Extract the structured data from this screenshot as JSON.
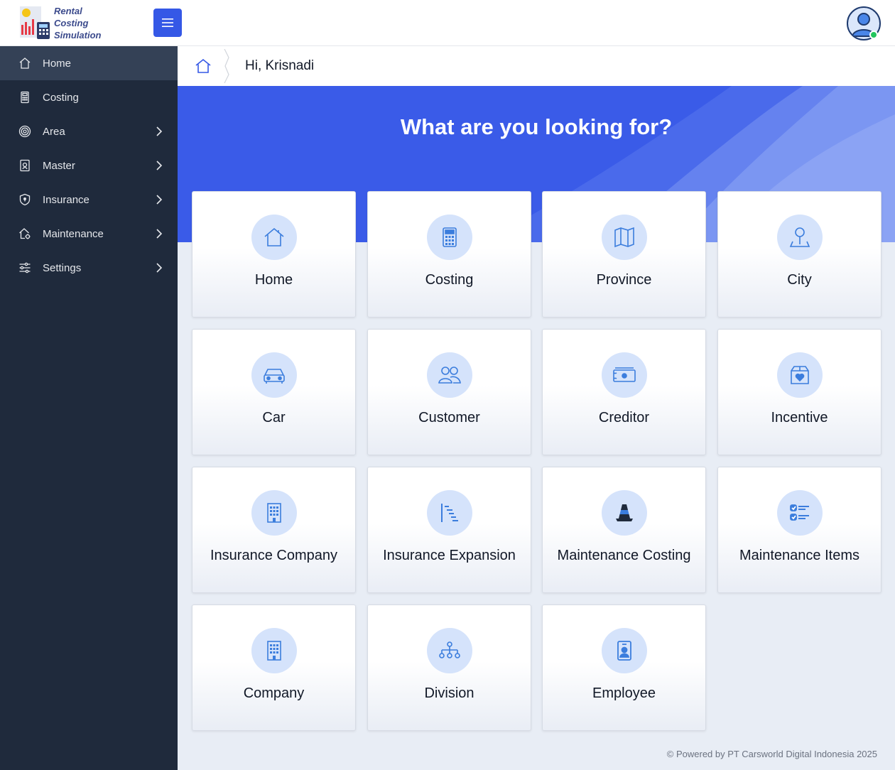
{
  "header": {
    "logo_line1": "Rental",
    "logo_line2": "Costing Simulation"
  },
  "sidebar": {
    "items": [
      {
        "label": "Home",
        "icon": "home-icon",
        "active": true,
        "has_submenu": false
      },
      {
        "label": "Costing",
        "icon": "calculator-icon",
        "active": false,
        "has_submenu": false
      },
      {
        "label": "Area",
        "icon": "target-icon",
        "active": false,
        "has_submenu": true
      },
      {
        "label": "Master",
        "icon": "folder-icon",
        "active": false,
        "has_submenu": true
      },
      {
        "label": "Insurance",
        "icon": "shield-icon",
        "active": false,
        "has_submenu": true
      },
      {
        "label": "Maintenance",
        "icon": "house-gear-icon",
        "active": false,
        "has_submenu": true
      },
      {
        "label": "Settings",
        "icon": "sliders-icon",
        "active": false,
        "has_submenu": true
      }
    ]
  },
  "breadcrumb": {
    "greeting": "Hi, Krisnadi"
  },
  "hero": {
    "title": "What are you looking for?"
  },
  "cards": [
    {
      "label": "Home",
      "icon": "home-icon"
    },
    {
      "label": "Costing",
      "icon": "calculator-icon"
    },
    {
      "label": "Province",
      "icon": "map-icon"
    },
    {
      "label": "City",
      "icon": "map-pin-icon"
    },
    {
      "label": "Car",
      "icon": "car-icon"
    },
    {
      "label": "Customer",
      "icon": "people-icon"
    },
    {
      "label": "Creditor",
      "icon": "cash-icon"
    },
    {
      "label": "Incentive",
      "icon": "box-heart-icon"
    },
    {
      "label": "Insurance Company",
      "icon": "building-icon"
    },
    {
      "label": "Insurance Expansion",
      "icon": "bar-align-icon"
    },
    {
      "label": "Maintenance Costing",
      "icon": "cone-icon"
    },
    {
      "label": "Maintenance Items",
      "icon": "checklist-icon"
    },
    {
      "label": "Company",
      "icon": "building-icon"
    },
    {
      "label": "Division",
      "icon": "org-chart-icon"
    },
    {
      "label": "Employee",
      "icon": "id-badge-icon"
    }
  ],
  "footer": {
    "text": "© Powered by PT Carsworld Digital Indonesia 2025"
  },
  "colors": {
    "primary": "#3558e6",
    "sidebar_bg": "#1f2a3c",
    "sidebar_active": "#344156",
    "icon_blue": "#3b7ddd",
    "icon_circle": "#d5e3fb",
    "online": "#22c55e"
  }
}
